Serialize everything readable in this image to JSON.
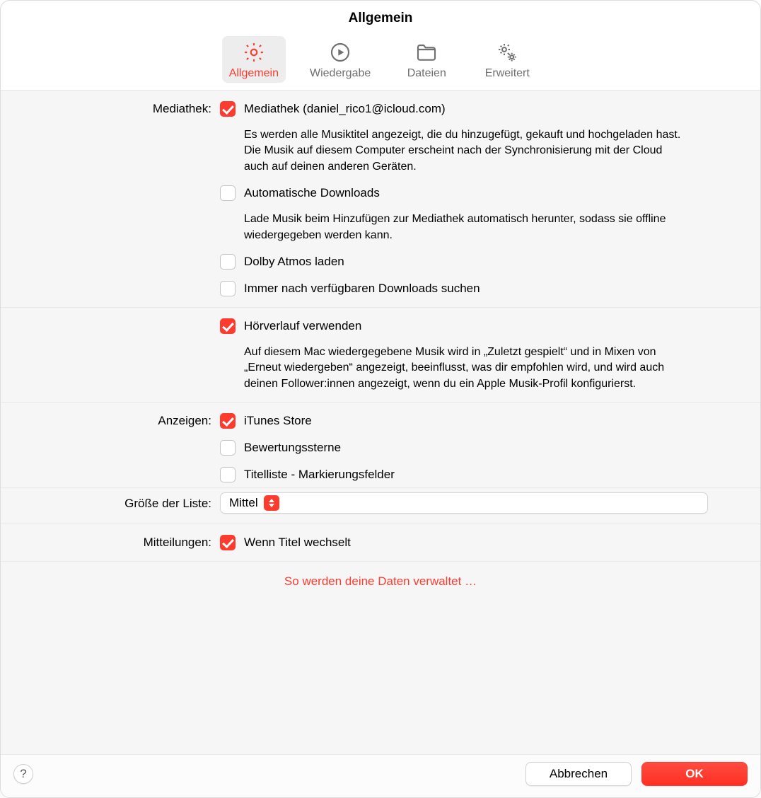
{
  "window": {
    "title": "Allgemein"
  },
  "tabs": {
    "general": "Allgemein",
    "playback": "Wiedergabe",
    "files": "Dateien",
    "advanced": "Erweitert"
  },
  "labels": {
    "library": "Mediathek:",
    "show": "Anzeigen:",
    "list_size": "Größe der Liste:",
    "notifications": "Mitteilungen:"
  },
  "library": {
    "main_label": "Mediathek (daniel_rico1@icloud.com)",
    "main_desc": "Es werden alle Musiktitel angezeigt, die du hinzugefügt, gekauft und hochgeladen hast. Die Musik auf diesem Computer erscheint nach der Synchronisierung mit der Cloud auch auf deinen anderen Geräten.",
    "auto_dl_label": "Automatische Downloads",
    "auto_dl_desc": "Lade Musik beim Hinzufügen zur Mediathek automatisch herunter, sodass sie offline wiedergegeben werden kann.",
    "dolby_label": "Dolby Atmos laden",
    "check_dl_label": "Immer nach verfügbaren Downloads suchen"
  },
  "history": {
    "use_label": "Hörverlauf verwenden",
    "use_desc": "Auf diesem Mac wiedergegebene Musik wird in „Zuletzt gespielt“ und in Mixen von „Erneut wiedergeben“ angezeigt, beeinflusst, was dir empfohlen wird, und wird auch deinen Follower:innen angezeigt, wenn du ein Apple Musik-Profil konfigurierst."
  },
  "show": {
    "itunes_label": "iTunes Store",
    "stars_label": "Bewertungssterne",
    "songlist_label": "Titelliste - Markierungsfelder"
  },
  "list_size_value": "Mittel",
  "notifications": {
    "song_change_label": "Wenn Titel wechselt"
  },
  "privacy_link": "So werden deine Daten verwaltet …",
  "footer": {
    "cancel": "Abbrechen",
    "ok": "OK"
  }
}
